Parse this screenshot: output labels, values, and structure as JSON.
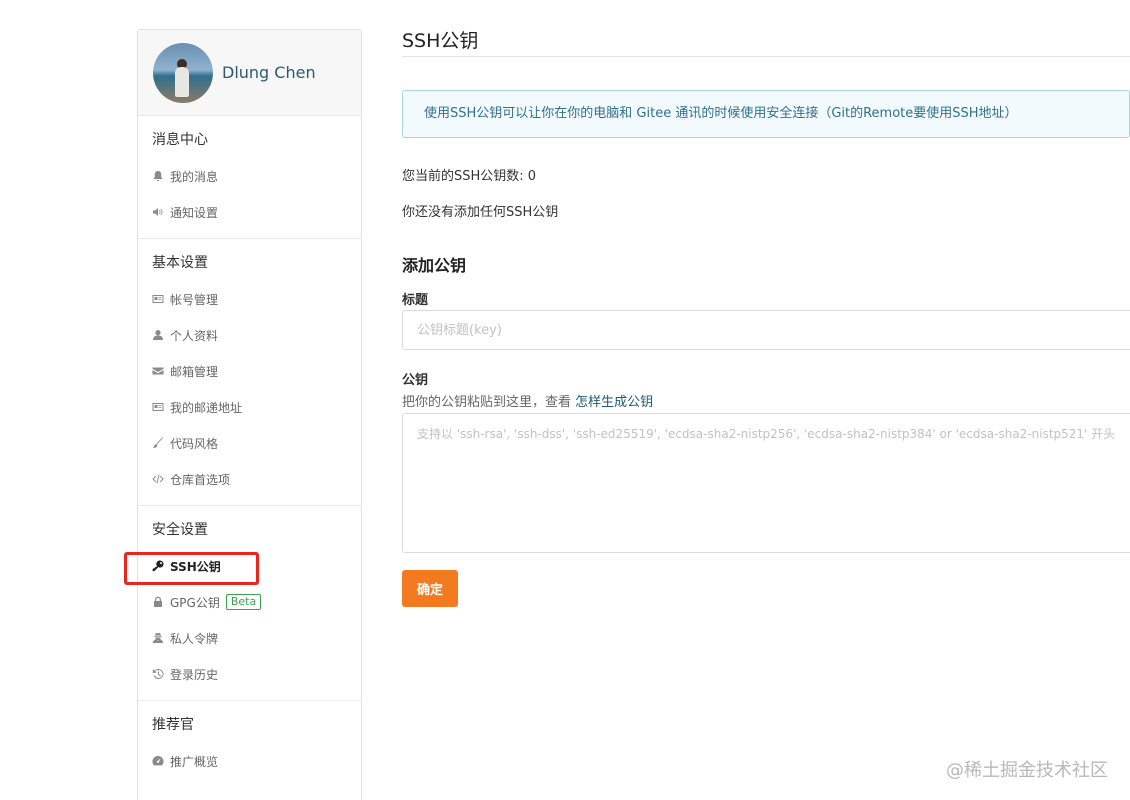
{
  "profile": {
    "name": "Dlung Chen"
  },
  "sidebar": {
    "sections": [
      {
        "title": "消息中心",
        "items": [
          {
            "label": "我的消息",
            "icon": "bell-icon"
          },
          {
            "label": "通知设置",
            "icon": "volume-icon"
          }
        ]
      },
      {
        "title": "基本设置",
        "items": [
          {
            "label": "帐号管理",
            "icon": "id-card-icon"
          },
          {
            "label": "个人资料",
            "icon": "user-icon"
          },
          {
            "label": "邮箱管理",
            "icon": "envelope-icon"
          },
          {
            "label": "我的邮递地址",
            "icon": "address-card-icon"
          },
          {
            "label": "代码风格",
            "icon": "paintbrush-icon"
          },
          {
            "label": "仓库首选项",
            "icon": "code-icon"
          }
        ]
      },
      {
        "title": "安全设置",
        "items": [
          {
            "label": "SSH公钥",
            "icon": "key-icon",
            "active": true
          },
          {
            "label": "GPG公钥",
            "icon": "lock-icon",
            "badge": "Beta"
          },
          {
            "label": "私人令牌",
            "icon": "user-secret-icon"
          },
          {
            "label": "登录历史",
            "icon": "history-icon"
          }
        ]
      },
      {
        "title": "推荐官",
        "items": [
          {
            "label": "推广概览",
            "icon": "dashboard-icon"
          }
        ]
      }
    ]
  },
  "main": {
    "title": "SSH公钥",
    "info": "使用SSH公钥可以让你在你的电脑和 Gitee 通讯的时候使用安全连接（Git的Remote要使用SSH地址）",
    "stat": "您当前的SSH公钥数: 0",
    "empty": "你还没有添加任何SSH公钥",
    "form": {
      "heading": "添加公钥",
      "title_label": "标题",
      "title_placeholder": "公钥标题(key)",
      "key_label": "公钥",
      "hint_text": "把你的公钥粘贴到这里，查看 ",
      "hint_link": "怎样生成公钥",
      "key_placeholder": "支持以 'ssh-rsa', 'ssh-dss', 'ssh-ed25519', 'ecdsa-sha2-nistp256', 'ecdsa-sha2-nistp384' or 'ecdsa-sha2-nistp521' 开头",
      "submit": "确定"
    }
  },
  "watermark": "@稀土掘金技术社区",
  "colors": {
    "accent": "#f47a1f",
    "info_text": "#31708f",
    "highlight": "#e8261e",
    "beta": "#3aa34d"
  }
}
